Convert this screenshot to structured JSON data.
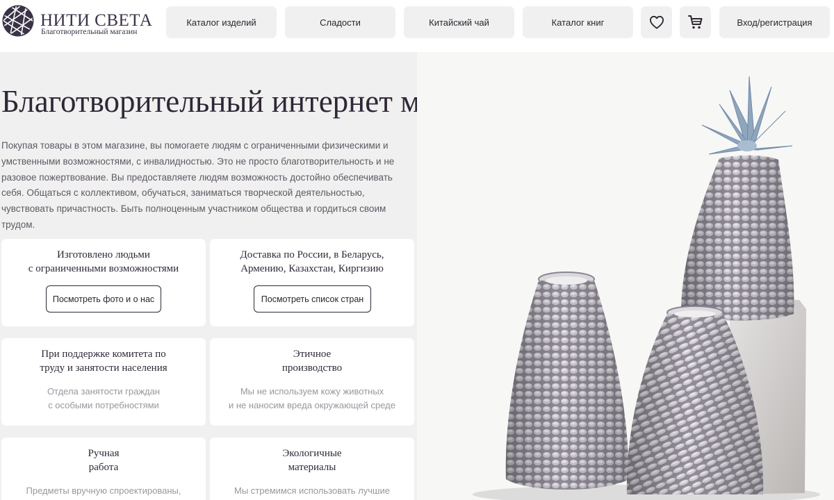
{
  "header": {
    "logo": {
      "title": "НИТИ СВЕТА",
      "subtitle": "Благотворительный магазин"
    },
    "nav": [
      {
        "label": "Каталог изделий"
      },
      {
        "label": "Сладости"
      },
      {
        "label": "Китайский чай"
      },
      {
        "label": "Каталог книг"
      }
    ],
    "icons": {
      "favorites": "heart-icon",
      "cart": "cart-icon"
    },
    "login_label": "Вход/регистрация"
  },
  "hero": {
    "title": "Благотворительный интернет магазин",
    "text": "Покупая товары в этом магазине, вы помогаете людям с ограниченными физическими и умственными возможностями, с инвалидностью. Это не просто благотворительность и не разовое пожертвование. Вы предоставляете людям возможность достойно обеспечивать себя. Общаться с коллективом, обучаться, заниматься творческой деятельностью, чувствовать причастность. Быть полноценным участником общества и гордиться своим трудом."
  },
  "cards": [
    {
      "title": "Изготовлено людьми\nс ограниченными возможностями",
      "button": "Посмотреть фото и о нас"
    },
    {
      "title": "Доставка по России, в Беларусь,\nАрмению, Казахстан, Киргизию",
      "button": "Посмотреть список стран"
    },
    {
      "title": "При поддержке комитета по\nтруду и занятости населения",
      "text": "Отдела занятости граждан\nс особыми потребностями"
    },
    {
      "title": "Этичное\nпроизводство",
      "text": "Мы не используем кожу животных\nи не наносим вреда окружающей среде"
    },
    {
      "title": "Ручная\nработа",
      "text": "Предметы вручную спроектированы,"
    },
    {
      "title": "Экологичные\nматериалы",
      "text": "Мы стремимся использовать лучшие"
    }
  ],
  "colors": {
    "brand": "#3a3246",
    "background": "#f1f0f0",
    "card": "#ffffff",
    "muted_text": "#9a969e"
  }
}
